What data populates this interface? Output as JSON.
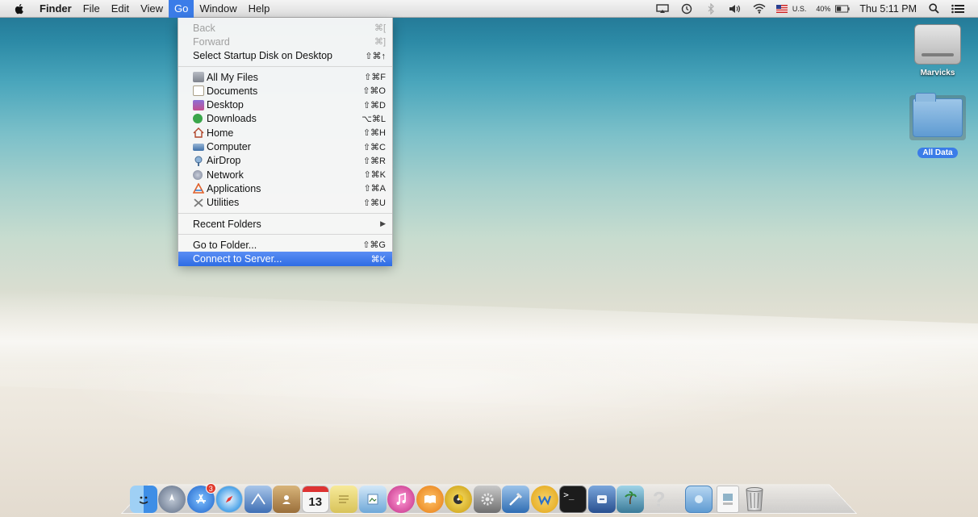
{
  "menubar": {
    "app_name": "Finder",
    "menus": [
      "File",
      "Edit",
      "View",
      "Go",
      "Window",
      "Help"
    ],
    "active_menu": "Go",
    "status": {
      "input_source": "U.S.",
      "battery": "40%",
      "clock": "Thu 5:11 PM"
    }
  },
  "go_menu": {
    "items": [
      {
        "label": "Back",
        "shortcut": "⌘[",
        "disabled": true
      },
      {
        "label": "Forward",
        "shortcut": "⌘]",
        "disabled": true
      },
      {
        "label": "Select Startup Disk on Desktop",
        "shortcut": "⇧⌘↑"
      },
      {
        "label": "All My Files",
        "shortcut": "⇧⌘F",
        "icon": "all-my-files-icon",
        "color": "#8a8f98"
      },
      {
        "label": "Documents",
        "shortcut": "⇧⌘O",
        "icon": "documents-icon",
        "color": "#d9d2c3"
      },
      {
        "label": "Desktop",
        "shortcut": "⇧⌘D",
        "icon": "desktop-icon",
        "color": "#6a5fc7"
      },
      {
        "label": "Downloads",
        "shortcut": "⌥⌘L",
        "icon": "downloads-icon",
        "color": "#3aa64a"
      },
      {
        "label": "Home",
        "shortcut": "⇧⌘H",
        "icon": "home-icon",
        "color": "#c9a36a"
      },
      {
        "label": "Computer",
        "shortcut": "⇧⌘C",
        "icon": "computer-icon",
        "color": "#6b8fb8"
      },
      {
        "label": "AirDrop",
        "shortcut": "⇧⌘R",
        "icon": "airdrop-icon",
        "color": "#7aa0c4"
      },
      {
        "label": "Network",
        "shortcut": "⇧⌘K",
        "icon": "network-icon",
        "color": "#8b93a8"
      },
      {
        "label": "Applications",
        "shortcut": "⇧⌘A",
        "icon": "applications-icon",
        "color": "#e0602a"
      },
      {
        "label": "Utilities",
        "shortcut": "⇧⌘U",
        "icon": "utilities-icon",
        "color": "#8a8a8a"
      },
      {
        "label": "Recent Folders",
        "submenu": "▶"
      },
      {
        "label": "Go to Folder...",
        "shortcut": "⇧⌘G"
      },
      {
        "label": "Connect to Server...",
        "shortcut": "⌘K",
        "selected": true
      }
    ]
  },
  "desktop_icons": [
    {
      "label": "Marvicks",
      "icon": "hard-drive-icon"
    },
    {
      "label": "All Data",
      "icon": "folder-icon",
      "selected": true
    }
  ],
  "dock": {
    "apps": [
      {
        "name": "finder-icon",
        "color": "#3e8ee6"
      },
      {
        "name": "launchpad-icon",
        "color": "#7a8aa3"
      },
      {
        "name": "app-store-icon",
        "color": "#2f7fe0",
        "badge": "3"
      },
      {
        "name": "safari-icon",
        "color": "#4aa2e8"
      },
      {
        "name": "mail-icon",
        "color": "#5b86c9"
      },
      {
        "name": "contacts-icon",
        "color": "#b98a4a"
      },
      {
        "name": "calendar-icon",
        "color": "#f2f2f2",
        "text": "13"
      },
      {
        "name": "notes-icon",
        "color": "#e8d67a"
      },
      {
        "name": "preview-icon",
        "color": "#7fb3de"
      },
      {
        "name": "itunes-icon",
        "color": "#d94a9a"
      },
      {
        "name": "ibooks-icon",
        "color": "#f08a1c"
      },
      {
        "name": "disk-burner-icon",
        "color": "#e4b516"
      },
      {
        "name": "system-preferences-icon",
        "color": "#8d8d8d"
      },
      {
        "name": "xcode-icon",
        "color": "#4a87c7"
      },
      {
        "name": "wunderlist-icon",
        "color": "#3d8ee6"
      },
      {
        "name": "terminal-icon",
        "color": "#202020",
        "text": ">_"
      },
      {
        "name": "migration-assistant-icon",
        "color": "#3c73b8"
      },
      {
        "name": "iphoto-icon",
        "color": "#5e8aa8"
      },
      {
        "name": "help-icon",
        "color": "#c4c4c4",
        "text": "?"
      }
    ],
    "others": [
      {
        "name": "applications-folder-icon",
        "color": "#7fb1dd"
      },
      {
        "name": "png-document-icon",
        "color": "#f4f4f4"
      },
      {
        "name": "trash-icon",
        "color": "#9a9a9a"
      }
    ]
  }
}
